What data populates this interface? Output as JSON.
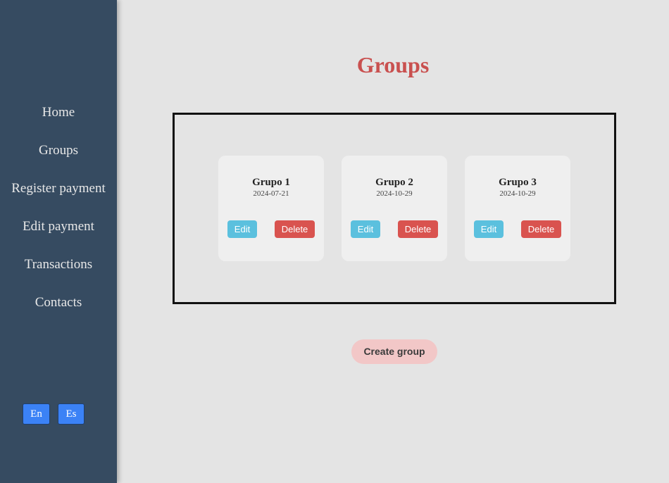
{
  "colors": {
    "sidebar": "#364b61",
    "page_background": "#e4e4e4",
    "title": "#c9504f",
    "edit_button": "#5bc0de",
    "delete_button": "#d9534f",
    "create_button": "#f2c7c7",
    "language_button": "#3b82f6"
  },
  "sidebar": {
    "items": [
      {
        "label": "Home"
      },
      {
        "label": "Groups"
      },
      {
        "label": "Register payment"
      },
      {
        "label": "Edit payment"
      },
      {
        "label": "Transactions"
      },
      {
        "label": "Contacts"
      }
    ],
    "languages": [
      {
        "label": "En"
      },
      {
        "label": "Es"
      }
    ]
  },
  "main": {
    "title": "Groups",
    "groups": [
      {
        "name": "Grupo 1",
        "date": "2024-07-21",
        "edit_label": "Edit",
        "delete_label": "Delete"
      },
      {
        "name": "Grupo 2",
        "date": "2024-10-29",
        "edit_label": "Edit",
        "delete_label": "Delete"
      },
      {
        "name": "Grupo 3",
        "date": "2024-10-29",
        "edit_label": "Edit",
        "delete_label": "Delete"
      }
    ],
    "create_label": "Create group"
  }
}
